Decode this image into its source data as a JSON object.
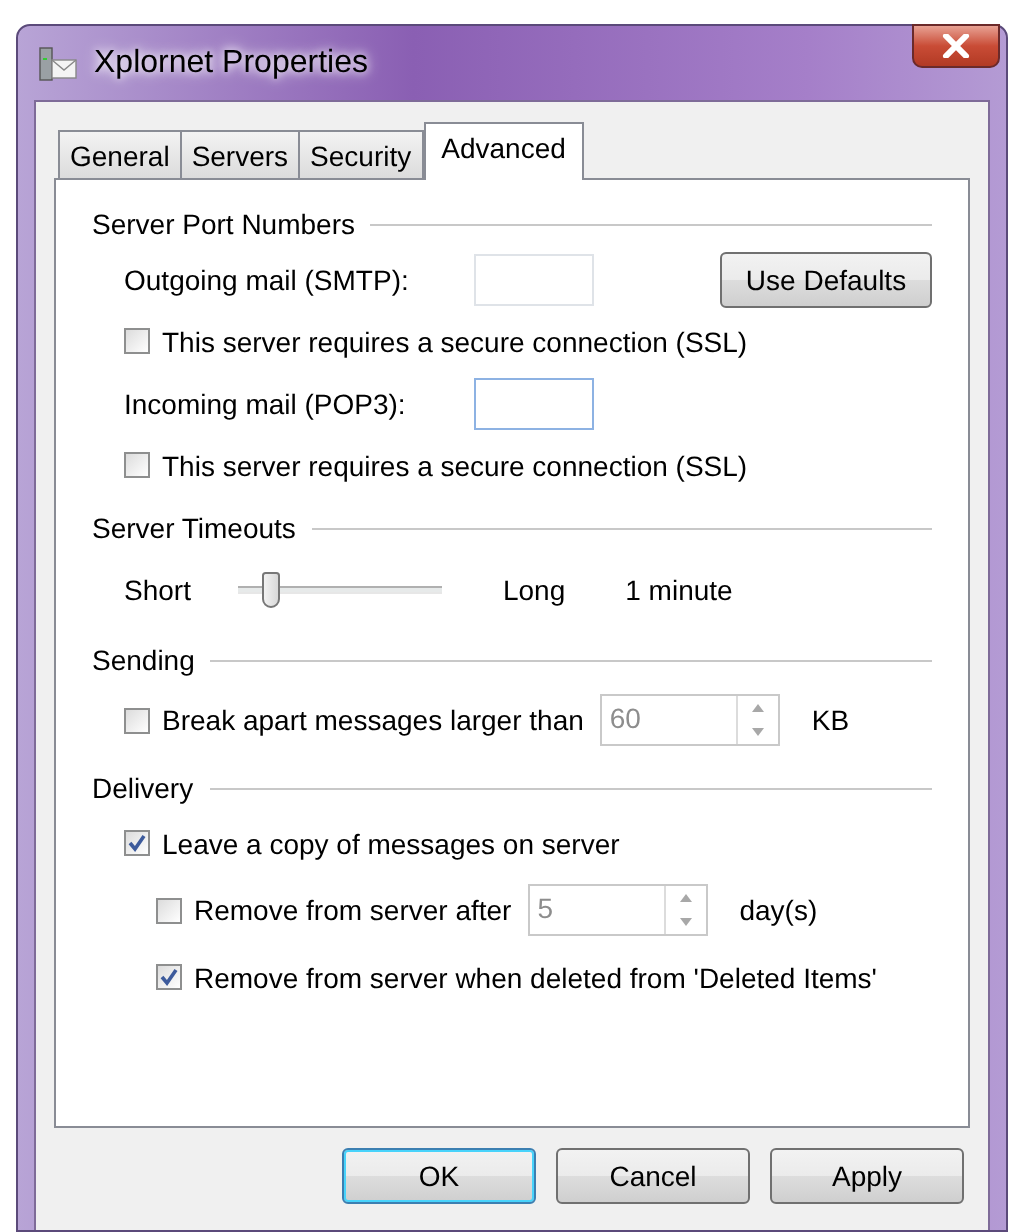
{
  "window": {
    "title": "Xplornet Properties"
  },
  "tabs": [
    {
      "label": "General",
      "selected": false
    },
    {
      "label": "Servers",
      "selected": false
    },
    {
      "label": "Security",
      "selected": false
    },
    {
      "label": "Advanced",
      "selected": true
    }
  ],
  "sections": [
    {
      "title": "Server Port Numbers",
      "items": [
        {
          "kind": "port",
          "label": "Outgoing mail (SMTP):",
          "focused": false,
          "button": "Use Defaults"
        },
        {
          "kind": "checkbox",
          "label": "This server requires a secure connection (SSL)",
          "checked": false
        },
        {
          "kind": "port",
          "label": "Incoming mail (POP3):",
          "focused": true
        },
        {
          "kind": "checkbox",
          "label": "This server requires a secure connection (SSL)",
          "checked": false
        }
      ]
    },
    {
      "title": "Server Timeouts",
      "items": [
        {
          "kind": "slider",
          "min_label": "Short",
          "max_label": "Long",
          "level": 0.15,
          "reading": "1 minute"
        }
      ]
    },
    {
      "title": "Sending",
      "items": [
        {
          "kind": "spin",
          "label": "Break apart messages larger than",
          "checked": false,
          "value": "60",
          "disabled": true,
          "unit": "KB"
        }
      ]
    },
    {
      "title": "Delivery",
      "items": [
        {
          "kind": "checkbox",
          "label": "Leave a copy of messages on server",
          "checked": true,
          "children": [
            {
              "kind": "spin",
              "label": "Remove from server after",
              "checked": false,
              "value": "5",
              "disabled": true,
              "unit": "day(s)"
            },
            {
              "kind": "checkbox",
              "label": "Remove from server when deleted from 'Deleted Items'",
              "checked": true
            }
          ]
        }
      ]
    }
  ],
  "buttons": [
    {
      "label": "OK",
      "default": true
    },
    {
      "label": "Cancel",
      "default": false
    },
    {
      "label": "Apply",
      "default": false
    }
  ]
}
